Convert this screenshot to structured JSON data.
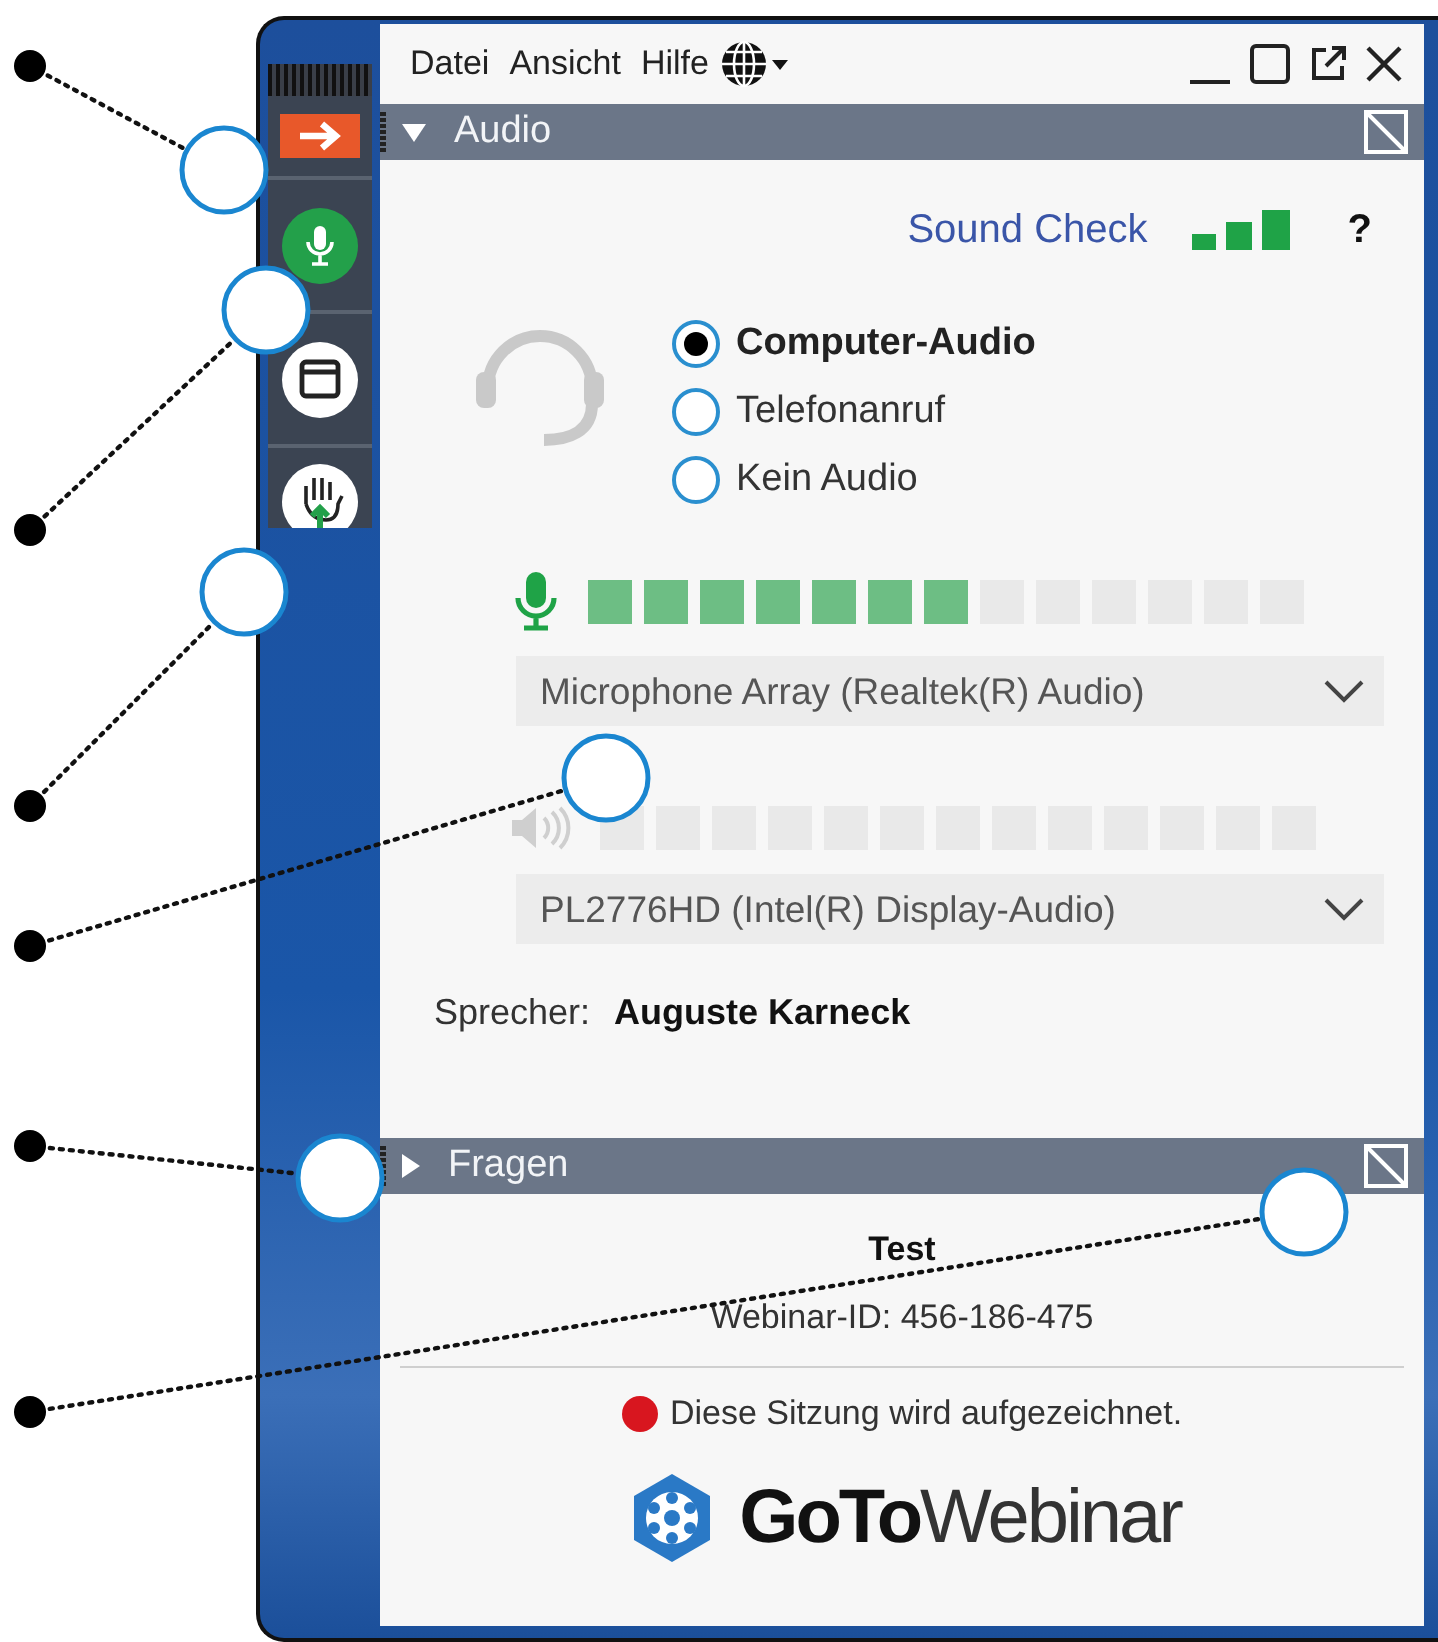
{
  "menu": [
    {
      "label": "Datei"
    },
    {
      "label": "Ansicht"
    },
    {
      "label": "Hilfe"
    }
  ],
  "toolbar": [
    {
      "kind": "exit"
    },
    {
      "kind": "microphone",
      "on": true
    },
    {
      "kind": "viewer"
    },
    {
      "kind": "hand"
    }
  ],
  "audio_section": {
    "title": "Audio",
    "expanded": true,
    "sound_check": "Sound Check",
    "help": "?",
    "options": [
      {
        "label": "Computer-Audio",
        "selected": true
      },
      {
        "label": "Telefonanruf",
        "selected": false
      },
      {
        "label": "Kein Audio",
        "selected": false
      }
    ],
    "microphone": {
      "level": 0.54,
      "device": "Microphone Array (Realtek(R) Audio)"
    },
    "speaker": {
      "device": "PL2776HD (Intel(R) Display-Audio)"
    },
    "presenter_label": "Sprecher:",
    "presenter_name": "Auguste Karneck"
  },
  "questions_section": {
    "title": "Fragen",
    "expanded": false
  },
  "webinar": {
    "title": "Test",
    "id": "Webinar-ID: 456-186-475",
    "recording_notice": "Diese Sitzung wird aufgezeichnet.",
    "logo_bold": "GoTo",
    "logo_light": "Webinar"
  }
}
